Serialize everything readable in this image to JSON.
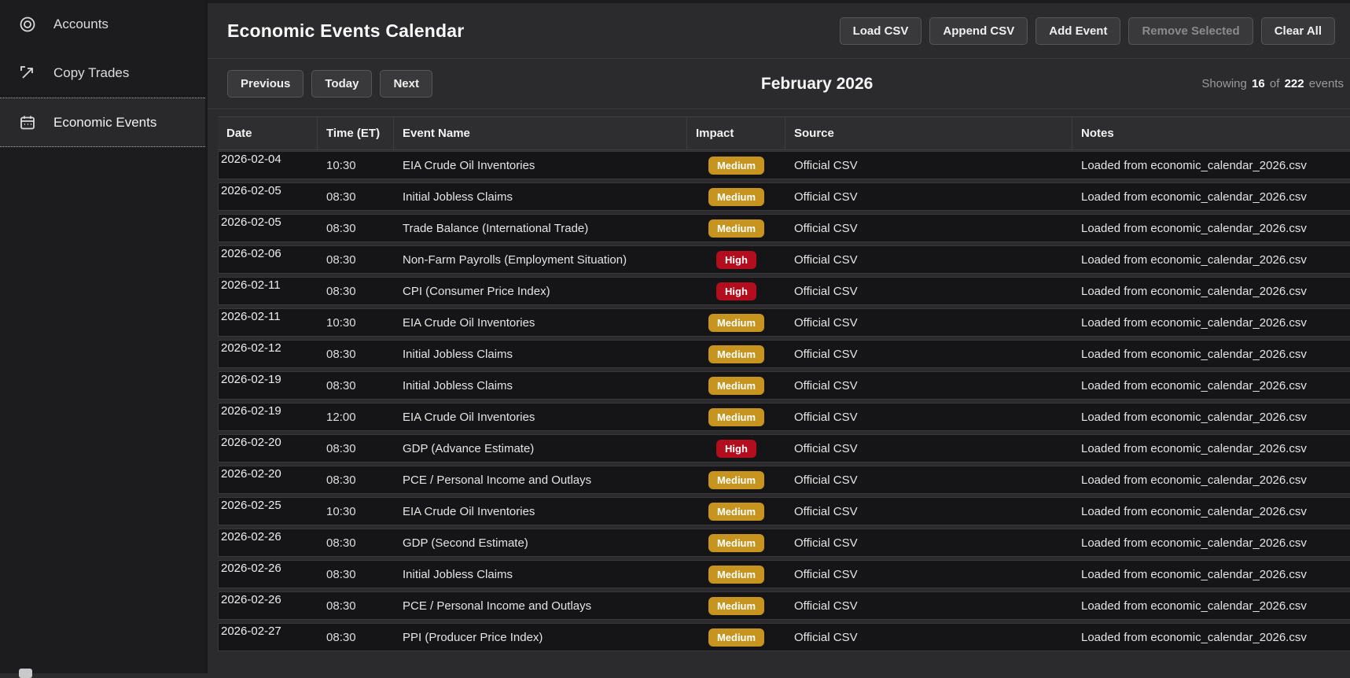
{
  "sidebar": {
    "items": [
      {
        "label": "Accounts",
        "icon": "target-icon",
        "selected": false
      },
      {
        "label": "Copy Trades",
        "icon": "copy-export-icon",
        "selected": false
      },
      {
        "label": "Economic Events",
        "icon": "calendar-icon",
        "selected": true
      }
    ]
  },
  "header": {
    "title": "Economic Events Calendar",
    "buttons": [
      {
        "label": "Load CSV",
        "disabled": false
      },
      {
        "label": "Append CSV",
        "disabled": false
      },
      {
        "label": "Add Event",
        "disabled": false
      },
      {
        "label": "Remove Selected",
        "disabled": true
      },
      {
        "label": "Clear All",
        "disabled": false
      }
    ]
  },
  "toolbar": {
    "nav_buttons": [
      "Previous",
      "Today",
      "Next"
    ],
    "month_title": "February 2026",
    "showing": {
      "prefix": "Showing",
      "count": "16",
      "middle": "of",
      "total": "222",
      "suffix": "events"
    }
  },
  "colors": {
    "impact_medium": "#c6941f",
    "impact_high": "#b30e1e"
  },
  "table": {
    "columns": [
      "Date",
      "Time (ET)",
      "Event Name",
      "Impact",
      "Source",
      "Notes"
    ],
    "rows": [
      {
        "date": "2026-02-04",
        "time": "10:30",
        "event": "EIA Crude Oil Inventories",
        "impact": "Medium",
        "source": "Official CSV",
        "notes": "Loaded from economic_calendar_2026.csv"
      },
      {
        "date": "2026-02-05",
        "time": "08:30",
        "event": "Initial Jobless Claims",
        "impact": "Medium",
        "source": "Official CSV",
        "notes": "Loaded from economic_calendar_2026.csv"
      },
      {
        "date": "2026-02-05",
        "time": "08:30",
        "event": "Trade Balance (International Trade)",
        "impact": "Medium",
        "source": "Official CSV",
        "notes": "Loaded from economic_calendar_2026.csv"
      },
      {
        "date": "2026-02-06",
        "time": "08:30",
        "event": "Non-Farm Payrolls (Employment Situation)",
        "impact": "High",
        "source": "Official CSV",
        "notes": "Loaded from economic_calendar_2026.csv"
      },
      {
        "date": "2026-02-11",
        "time": "08:30",
        "event": "CPI (Consumer Price Index)",
        "impact": "High",
        "source": "Official CSV",
        "notes": "Loaded from economic_calendar_2026.csv"
      },
      {
        "date": "2026-02-11",
        "time": "10:30",
        "event": "EIA Crude Oil Inventories",
        "impact": "Medium",
        "source": "Official CSV",
        "notes": "Loaded from economic_calendar_2026.csv"
      },
      {
        "date": "2026-02-12",
        "time": "08:30",
        "event": "Initial Jobless Claims",
        "impact": "Medium",
        "source": "Official CSV",
        "notes": "Loaded from economic_calendar_2026.csv"
      },
      {
        "date": "2026-02-19",
        "time": "08:30",
        "event": "Initial Jobless Claims",
        "impact": "Medium",
        "source": "Official CSV",
        "notes": "Loaded from economic_calendar_2026.csv"
      },
      {
        "date": "2026-02-19",
        "time": "12:00",
        "event": "EIA Crude Oil Inventories",
        "impact": "Medium",
        "source": "Official CSV",
        "notes": "Loaded from economic_calendar_2026.csv"
      },
      {
        "date": "2026-02-20",
        "time": "08:30",
        "event": "GDP (Advance Estimate)",
        "impact": "High",
        "source": "Official CSV",
        "notes": "Loaded from economic_calendar_2026.csv"
      },
      {
        "date": "2026-02-20",
        "time": "08:30",
        "event": "PCE / Personal Income and Outlays",
        "impact": "Medium",
        "source": "Official CSV",
        "notes": "Loaded from economic_calendar_2026.csv"
      },
      {
        "date": "2026-02-25",
        "time": "10:30",
        "event": "EIA Crude Oil Inventories",
        "impact": "Medium",
        "source": "Official CSV",
        "notes": "Loaded from economic_calendar_2026.csv"
      },
      {
        "date": "2026-02-26",
        "time": "08:30",
        "event": "GDP (Second Estimate)",
        "impact": "Medium",
        "source": "Official CSV",
        "notes": "Loaded from economic_calendar_2026.csv"
      },
      {
        "date": "2026-02-26",
        "time": "08:30",
        "event": "Initial Jobless Claims",
        "impact": "Medium",
        "source": "Official CSV",
        "notes": "Loaded from economic_calendar_2026.csv"
      },
      {
        "date": "2026-02-26",
        "time": "08:30",
        "event": "PCE / Personal Income and Outlays",
        "impact": "Medium",
        "source": "Official CSV",
        "notes": "Loaded from economic_calendar_2026.csv"
      },
      {
        "date": "2026-02-27",
        "time": "08:30",
        "event": "PPI (Producer Price Index)",
        "impact": "Medium",
        "source": "Official CSV",
        "notes": "Loaded from economic_calendar_2026.csv"
      }
    ]
  }
}
